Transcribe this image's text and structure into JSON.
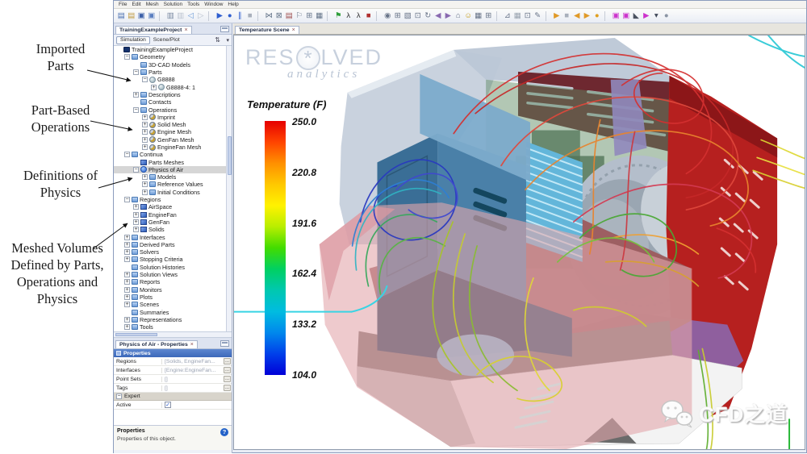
{
  "window": {
    "menu": [
      "File",
      "Edit",
      "Mesh",
      "Solution",
      "Tools",
      "Window",
      "Help"
    ]
  },
  "toolbar": {
    "icons": [
      {
        "name": "new-simulation-icon",
        "glyph": "▤",
        "color": "#4a6fb0"
      },
      {
        "name": "open-icon",
        "glyph": "▤",
        "color": "#c09a40"
      },
      {
        "name": "save-icon",
        "glyph": "▣",
        "color": "#3a5fa8"
      },
      {
        "name": "save-all-icon",
        "glyph": "▣",
        "color": "#5a7fc0"
      },
      {
        "sep": "true"
      },
      {
        "name": "copy-icon",
        "glyph": "▥",
        "color": "#7888a0"
      },
      {
        "name": "paste-icon",
        "glyph": "▥",
        "color": "#bcc4d0"
      },
      {
        "name": "back-icon",
        "glyph": "◁",
        "color": "#6a9ad8"
      },
      {
        "name": "forward-icon",
        "glyph": "▷",
        "color": "#b8c0cc"
      },
      {
        "sep": "true"
      },
      {
        "name": "run-simulation-icon",
        "glyph": "▶",
        "color": "#2f5fd0"
      },
      {
        "name": "record-icon",
        "glyph": "●",
        "color": "#2f5fd0"
      },
      {
        "name": "pause-icon",
        "glyph": "∥",
        "color": "#2f5fd0"
      },
      {
        "name": "stop-icon",
        "glyph": "■",
        "color": "#a8b0bc"
      },
      {
        "sep": "true"
      },
      {
        "name": "generate-mesh-icon",
        "glyph": "⋈",
        "color": "#68788c"
      },
      {
        "name": "clear-mesh-icon",
        "glyph": "⊠",
        "color": "#68788c"
      },
      {
        "name": "new-report-icon",
        "glyph": "▤",
        "color": "#a05050"
      },
      {
        "name": "flag-icon",
        "glyph": "⚐",
        "color": "#68788c"
      },
      {
        "name": "link-parts-icon",
        "glyph": "⊞",
        "color": "#68788c"
      },
      {
        "name": "table-icon",
        "glyph": "▦",
        "color": "#68788c"
      },
      {
        "sep": "true"
      },
      {
        "name": "green-flag-icon",
        "glyph": "⚑",
        "color": "#2e9e3a"
      },
      {
        "name": "walk-person-icon",
        "glyph": "λ",
        "color": "#303030"
      },
      {
        "name": "run-person-icon",
        "glyph": "λ",
        "color": "#303030"
      },
      {
        "name": "red-stop-icon",
        "glyph": "■",
        "color": "#b03030"
      },
      {
        "sep": "true"
      },
      {
        "name": "save-view-icon",
        "glyph": "◉",
        "color": "#687488"
      },
      {
        "name": "restore-view-icon",
        "glyph": "⊞",
        "color": "#687488"
      },
      {
        "name": "zoom-box-icon",
        "glyph": "▧",
        "color": "#687488"
      },
      {
        "name": "select-tool-icon",
        "glyph": "⊡",
        "color": "#687488"
      },
      {
        "name": "rotate-view-icon",
        "glyph": "↻",
        "color": "#687488"
      },
      {
        "name": "previous-view-icon",
        "glyph": "◀",
        "color": "#8a6ab0"
      },
      {
        "name": "next-view-icon",
        "glyph": "▶",
        "color": "#8a6ab0"
      },
      {
        "name": "home-view-icon",
        "glyph": "⌂",
        "color": "#687488"
      },
      {
        "name": "user-icon",
        "glyph": "☺",
        "color": "#c8a020"
      },
      {
        "name": "grid-icon",
        "glyph": "▦",
        "color": "#687488"
      },
      {
        "name": "spreadsheet-icon",
        "glyph": "⊞",
        "color": "#687488"
      },
      {
        "sep": "true"
      },
      {
        "name": "scene-hardcopy-icon",
        "glyph": "⊿",
        "color": "#687488"
      },
      {
        "name": "mesh-display-icon",
        "glyph": "▦",
        "color": "#9aa4b0"
      },
      {
        "name": "region-select-icon",
        "glyph": "⊡",
        "color": "#687488"
      },
      {
        "name": "probe-icon",
        "glyph": "✎",
        "color": "#687488"
      },
      {
        "sep": "true"
      },
      {
        "name": "play-animation-icon",
        "glyph": "▶",
        "color": "#e09a28"
      },
      {
        "name": "stop-animation-icon",
        "glyph": "■",
        "color": "#a8b0bc"
      },
      {
        "name": "step-back-icon",
        "glyph": "◀",
        "color": "#e09a28"
      },
      {
        "name": "step-forward-icon",
        "glyph": "▶",
        "color": "#e09a28"
      },
      {
        "name": "record-animation-icon",
        "glyph": "●",
        "color": "#e0a020"
      },
      {
        "sep": "true"
      },
      {
        "name": "new-scene-icon",
        "glyph": "▣",
        "color": "#cc33cc"
      },
      {
        "name": "new-plot-icon",
        "glyph": "▣",
        "color": "#cc33cc"
      },
      {
        "name": "dark-arrow-icon",
        "glyph": "◣",
        "color": "#4a5260"
      },
      {
        "name": "pointer-dropdown-icon",
        "glyph": "▶",
        "color": "#cc33cc"
      },
      {
        "name": "dropdown-caret-icon",
        "glyph": "▾",
        "color": "#404858"
      },
      {
        "name": "help-circle-icon",
        "glyph": "●",
        "color": "#8a94a4"
      }
    ]
  },
  "project_panel": {
    "tab": "TrainingExampleProject",
    "close": "×",
    "mode_button": "Simulation",
    "mode_label": "Scene/Plot",
    "sort_icon": "⇅",
    "dropdown_icon": "▾",
    "tree": [
      {
        "label": "TrainingExampleProject",
        "indent": 0,
        "icon": "root",
        "exp": "none"
      },
      {
        "label": "Geometry",
        "indent": 1,
        "icon": "folder",
        "exp": "minus"
      },
      {
        "label": "3D-CAD Models",
        "indent": 2,
        "icon": "folder",
        "exp": "none"
      },
      {
        "label": "Parts",
        "indent": 2,
        "icon": "folder",
        "exp": "minus"
      },
      {
        "label": "G8888",
        "indent": 3,
        "icon": "ball-gray",
        "exp": "minus"
      },
      {
        "label": "G8888-4: 1",
        "indent": 4,
        "icon": "ball-gray",
        "exp": "plus"
      },
      {
        "label": "Descriptions",
        "indent": 2,
        "icon": "folder",
        "exp": "plus"
      },
      {
        "label": "Contacts",
        "indent": 2,
        "icon": "folder",
        "exp": "none"
      },
      {
        "label": "Operations",
        "indent": 2,
        "icon": "folder",
        "exp": "minus"
      },
      {
        "label": "Imprint",
        "indent": 3,
        "icon": "gear",
        "exp": "plus"
      },
      {
        "label": "Solid Mesh",
        "indent": 3,
        "icon": "gear",
        "exp": "plus"
      },
      {
        "label": "Engine Mesh",
        "indent": 3,
        "icon": "gear",
        "exp": "plus"
      },
      {
        "label": "GenFan Mesh",
        "indent": 3,
        "icon": "gear",
        "exp": "plus"
      },
      {
        "label": "EngineFan Mesh",
        "indent": 3,
        "icon": "gear",
        "exp": "plus"
      },
      {
        "label": "Continua",
        "indent": 1,
        "icon": "folder",
        "exp": "minus"
      },
      {
        "label": "Parts Meshes",
        "indent": 2,
        "icon": "mesh",
        "exp": "none"
      },
      {
        "label": "Physics of Air",
        "indent": 2,
        "icon": "ball-blue",
        "exp": "minus",
        "sel": "true"
      },
      {
        "label": "Models",
        "indent": 3,
        "icon": "folder",
        "exp": "plus"
      },
      {
        "label": "Reference Values",
        "indent": 3,
        "icon": "folder",
        "exp": "plus"
      },
      {
        "label": "Initial Conditions",
        "indent": 3,
        "icon": "folder",
        "exp": "plus"
      },
      {
        "label": "Regions",
        "indent": 1,
        "icon": "folder",
        "exp": "minus"
      },
      {
        "label": "AirSpace",
        "indent": 2,
        "icon": "cube",
        "exp": "plus"
      },
      {
        "label": "EngineFan",
        "indent": 2,
        "icon": "cube",
        "exp": "plus"
      },
      {
        "label": "GenFan",
        "indent": 2,
        "icon": "cube",
        "exp": "plus"
      },
      {
        "label": "Solids",
        "indent": 2,
        "icon": "cube",
        "exp": "plus"
      },
      {
        "label": "Interfaces",
        "indent": 1,
        "icon": "folder",
        "exp": "plus"
      },
      {
        "label": "Derived Parts",
        "indent": 1,
        "icon": "folder",
        "exp": "plus"
      },
      {
        "label": "Solvers",
        "indent": 1,
        "icon": "folder",
        "exp": "plus"
      },
      {
        "label": "Stopping Criteria",
        "indent": 1,
        "icon": "folder",
        "exp": "plus"
      },
      {
        "label": "Solution Histories",
        "indent": 1,
        "icon": "folder",
        "exp": "none"
      },
      {
        "label": "Solution Views",
        "indent": 1,
        "icon": "folder",
        "exp": "plus"
      },
      {
        "label": "Reports",
        "indent": 1,
        "icon": "folder",
        "exp": "plus"
      },
      {
        "label": "Monitors",
        "indent": 1,
        "icon": "folder",
        "exp": "plus"
      },
      {
        "label": "Plots",
        "indent": 1,
        "icon": "folder",
        "exp": "plus"
      },
      {
        "label": "Scenes",
        "indent": 1,
        "icon": "folder",
        "exp": "plus"
      },
      {
        "label": "Summaries",
        "indent": 1,
        "icon": "folder",
        "exp": "none"
      },
      {
        "label": "Representations",
        "indent": 1,
        "icon": "folder",
        "exp": "plus"
      },
      {
        "label": "Tools",
        "indent": 1,
        "icon": "folder",
        "exp": "plus"
      }
    ]
  },
  "properties_panel": {
    "tab": "Physics of Air - Properties",
    "close": "×",
    "section_properties": "Properties",
    "rows": [
      {
        "label": "Regions",
        "value": "[Solids, EngineFan..."
      },
      {
        "label": "Interfaces",
        "value": "[Engine:EngineFan..."
      },
      {
        "label": "Point Sets",
        "value": "[]"
      },
      {
        "label": "Tags",
        "value": "[]"
      }
    ],
    "section_expert": "Expert",
    "active_label": "Active",
    "check_icon": "✓",
    "ellipsis": "...",
    "help_title": "Properties",
    "help_text": "Properties of this object.",
    "help_icon": "?"
  },
  "scene": {
    "tab": "Temperature Scene",
    "close": "×",
    "logo": {
      "part1": "RES",
      "part2": "LVED",
      "fan": "*",
      "script": "analytics"
    },
    "legend": {
      "title": "Temperature (F)",
      "ticks": [
        "250.0",
        "220.8",
        "191.6",
        "162.4",
        "133.2",
        "104.0"
      ],
      "gradient": [
        "#e60000",
        "#ff4400",
        "#ff9000",
        "#ffc800",
        "#fff200",
        "#b8ee00",
        "#42dc00",
        "#00d062",
        "#00c8b0",
        "#00bce0",
        "#0088ec",
        "#0040ea",
        "#0000d8"
      ]
    },
    "watermark": {
      "text": "CFD之道"
    }
  },
  "annotations": [
    {
      "text": "Imported\nParts"
    },
    {
      "text": "Part-Based\nOperations"
    },
    {
      "text": "Definitions of\nPhysics"
    },
    {
      "text": "Meshed Volumes\nDefined by Parts,\nOperations and\nPhysics"
    }
  ]
}
